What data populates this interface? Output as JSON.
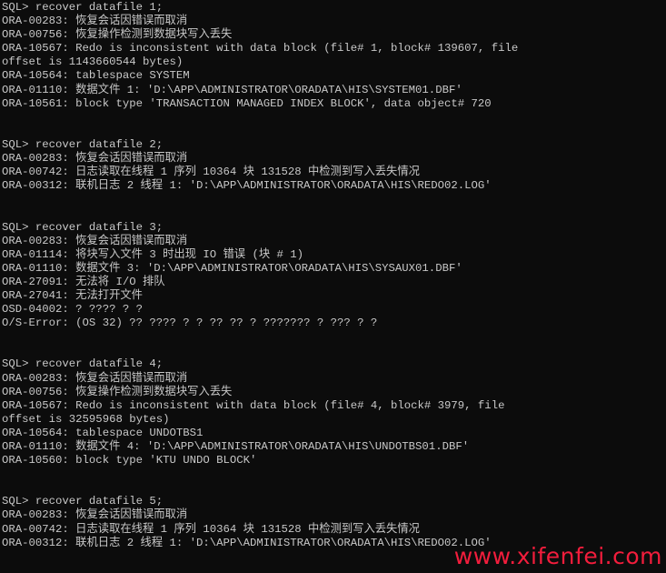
{
  "console": {
    "lines": [
      "SQL> recover datafile 1;",
      "ORA-00283: 恢复会话因错误而取消",
      "ORA-00756: 恢复操作检测到数据块写入丢失",
      "ORA-10567: Redo is inconsistent with data block (file# 1, block# 139607, file",
      "offset is 1143660544 bytes)",
      "ORA-10564: tablespace SYSTEM",
      "ORA-01110: 数据文件 1: 'D:\\APP\\ADMINISTRATOR\\ORADATA\\HIS\\SYSTEM01.DBF'",
      "ORA-10561: block type 'TRANSACTION MANAGED INDEX BLOCK', data object# 720",
      "",
      "",
      "SQL> recover datafile 2;",
      "ORA-00283: 恢复会话因错误而取消",
      "ORA-00742: 日志读取在线程 1 序列 10364 块 131528 中检测到写入丢失情况",
      "ORA-00312: 联机日志 2 线程 1: 'D:\\APP\\ADMINISTRATOR\\ORADATA\\HIS\\REDO02.LOG'",
      "",
      "",
      "SQL> recover datafile 3;",
      "ORA-00283: 恢复会话因错误而取消",
      "ORA-01114: 将块写入文件 3 时出现 IO 错误 (块 # 1)",
      "ORA-01110: 数据文件 3: 'D:\\APP\\ADMINISTRATOR\\ORADATA\\HIS\\SYSAUX01.DBF'",
      "ORA-27091: 无法将 I/O 排队",
      "ORA-27041: 无法打开文件",
      "OSD-04002: ? ???? ? ?",
      "O/S-Error: (OS 32) ?? ???? ? ? ?? ?? ? ??????? ? ??? ? ?",
      "",
      "",
      "SQL> recover datafile 4;",
      "ORA-00283: 恢复会话因错误而取消",
      "ORA-00756: 恢复操作检测到数据块写入丢失",
      "ORA-10567: Redo is inconsistent with data block (file# 4, block# 3979, file",
      "offset is 32595968 bytes)",
      "ORA-10564: tablespace UNDOTBS1",
      "ORA-01110: 数据文件 4: 'D:\\APP\\ADMINISTRATOR\\ORADATA\\HIS\\UNDOTBS01.DBF'",
      "ORA-10560: block type 'KTU UNDO BLOCK'",
      "",
      "",
      "SQL> recover datafile 5;",
      "ORA-00283: 恢复会话因错误而取消",
      "ORA-00742: 日志读取在线程 1 序列 10364 块 131528 中检测到写入丢失情况",
      "ORA-00312: 联机日志 2 线程 1: 'D:\\APP\\ADMINISTRATOR\\ORADATA\\HIS\\REDO02.LOG'"
    ]
  },
  "watermark": "www.xifenfei.com",
  "colors": {
    "background": "#0c0c0c",
    "text": "#c8c8c8",
    "watermark": "#f21d3c"
  }
}
